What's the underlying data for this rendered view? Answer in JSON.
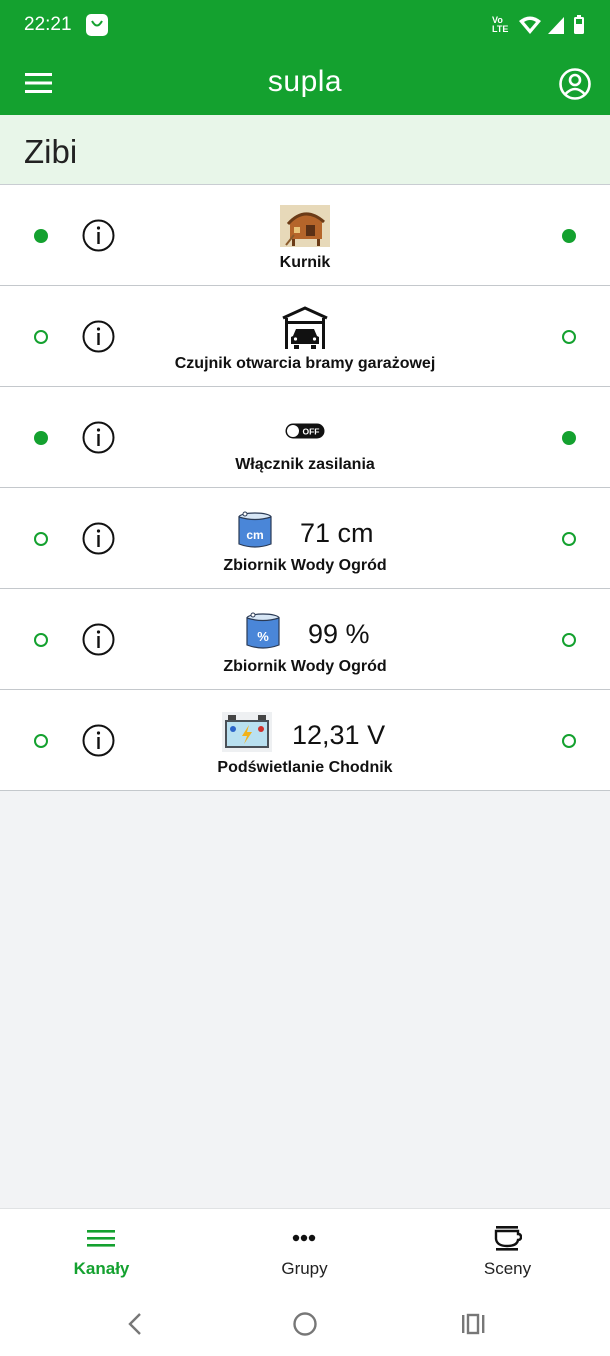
{
  "status_bar": {
    "time": "22:21",
    "network_label_top": "Vo",
    "network_label_bottom": "LTE",
    "icons": [
      "notification-bag-icon",
      "wifi-icon",
      "signal-icon",
      "battery-icon"
    ]
  },
  "app_bar": {
    "title": "supla",
    "menu_icon": "hamburger-menu-icon",
    "account_icon": "account-circle-icon"
  },
  "location": {
    "name": "Zibi"
  },
  "channels": [
    {
      "label": "Kurnik",
      "icon": "chicken-coop-icon",
      "value": "",
      "status_left": "on",
      "status_right": "on"
    },
    {
      "label": "Czujnik otwarcia bramy garażowej",
      "icon": "garage-door-icon",
      "value": "",
      "status_left": "off",
      "status_right": "off"
    },
    {
      "label": "Włącznik zasilania",
      "icon": "power-switch-off-icon",
      "icon_text": "OFF",
      "value": "",
      "status_left": "on",
      "status_right": "on"
    },
    {
      "label": "Zbiornik Wody Ogród",
      "icon": "water-tank-cm-icon",
      "icon_text": "cm",
      "value": "71 cm",
      "status_left": "off",
      "status_right": "off"
    },
    {
      "label": "Zbiornik Wody Ogród",
      "icon": "water-tank-percent-icon",
      "icon_text": "%",
      "value": "99 %",
      "status_left": "off",
      "status_right": "off"
    },
    {
      "label": "Podświetlanie Chodnik",
      "icon": "battery-voltage-icon",
      "value": "12,31 V",
      "status_left": "off",
      "status_right": "off"
    }
  ],
  "bottom_nav": {
    "tabs": [
      {
        "label": "Kanały",
        "icon": "list-icon",
        "active": true
      },
      {
        "label": "Grupy",
        "icon": "more-dots-icon",
        "active": false
      },
      {
        "label": "Sceny",
        "icon": "cup-icon",
        "active": false
      }
    ]
  },
  "system_nav": [
    "back-icon",
    "home-icon",
    "recents-icon"
  ],
  "colors": {
    "primary": "#14a12f",
    "location_bg": "#e8f6e9",
    "background": "#f2f3f5"
  }
}
